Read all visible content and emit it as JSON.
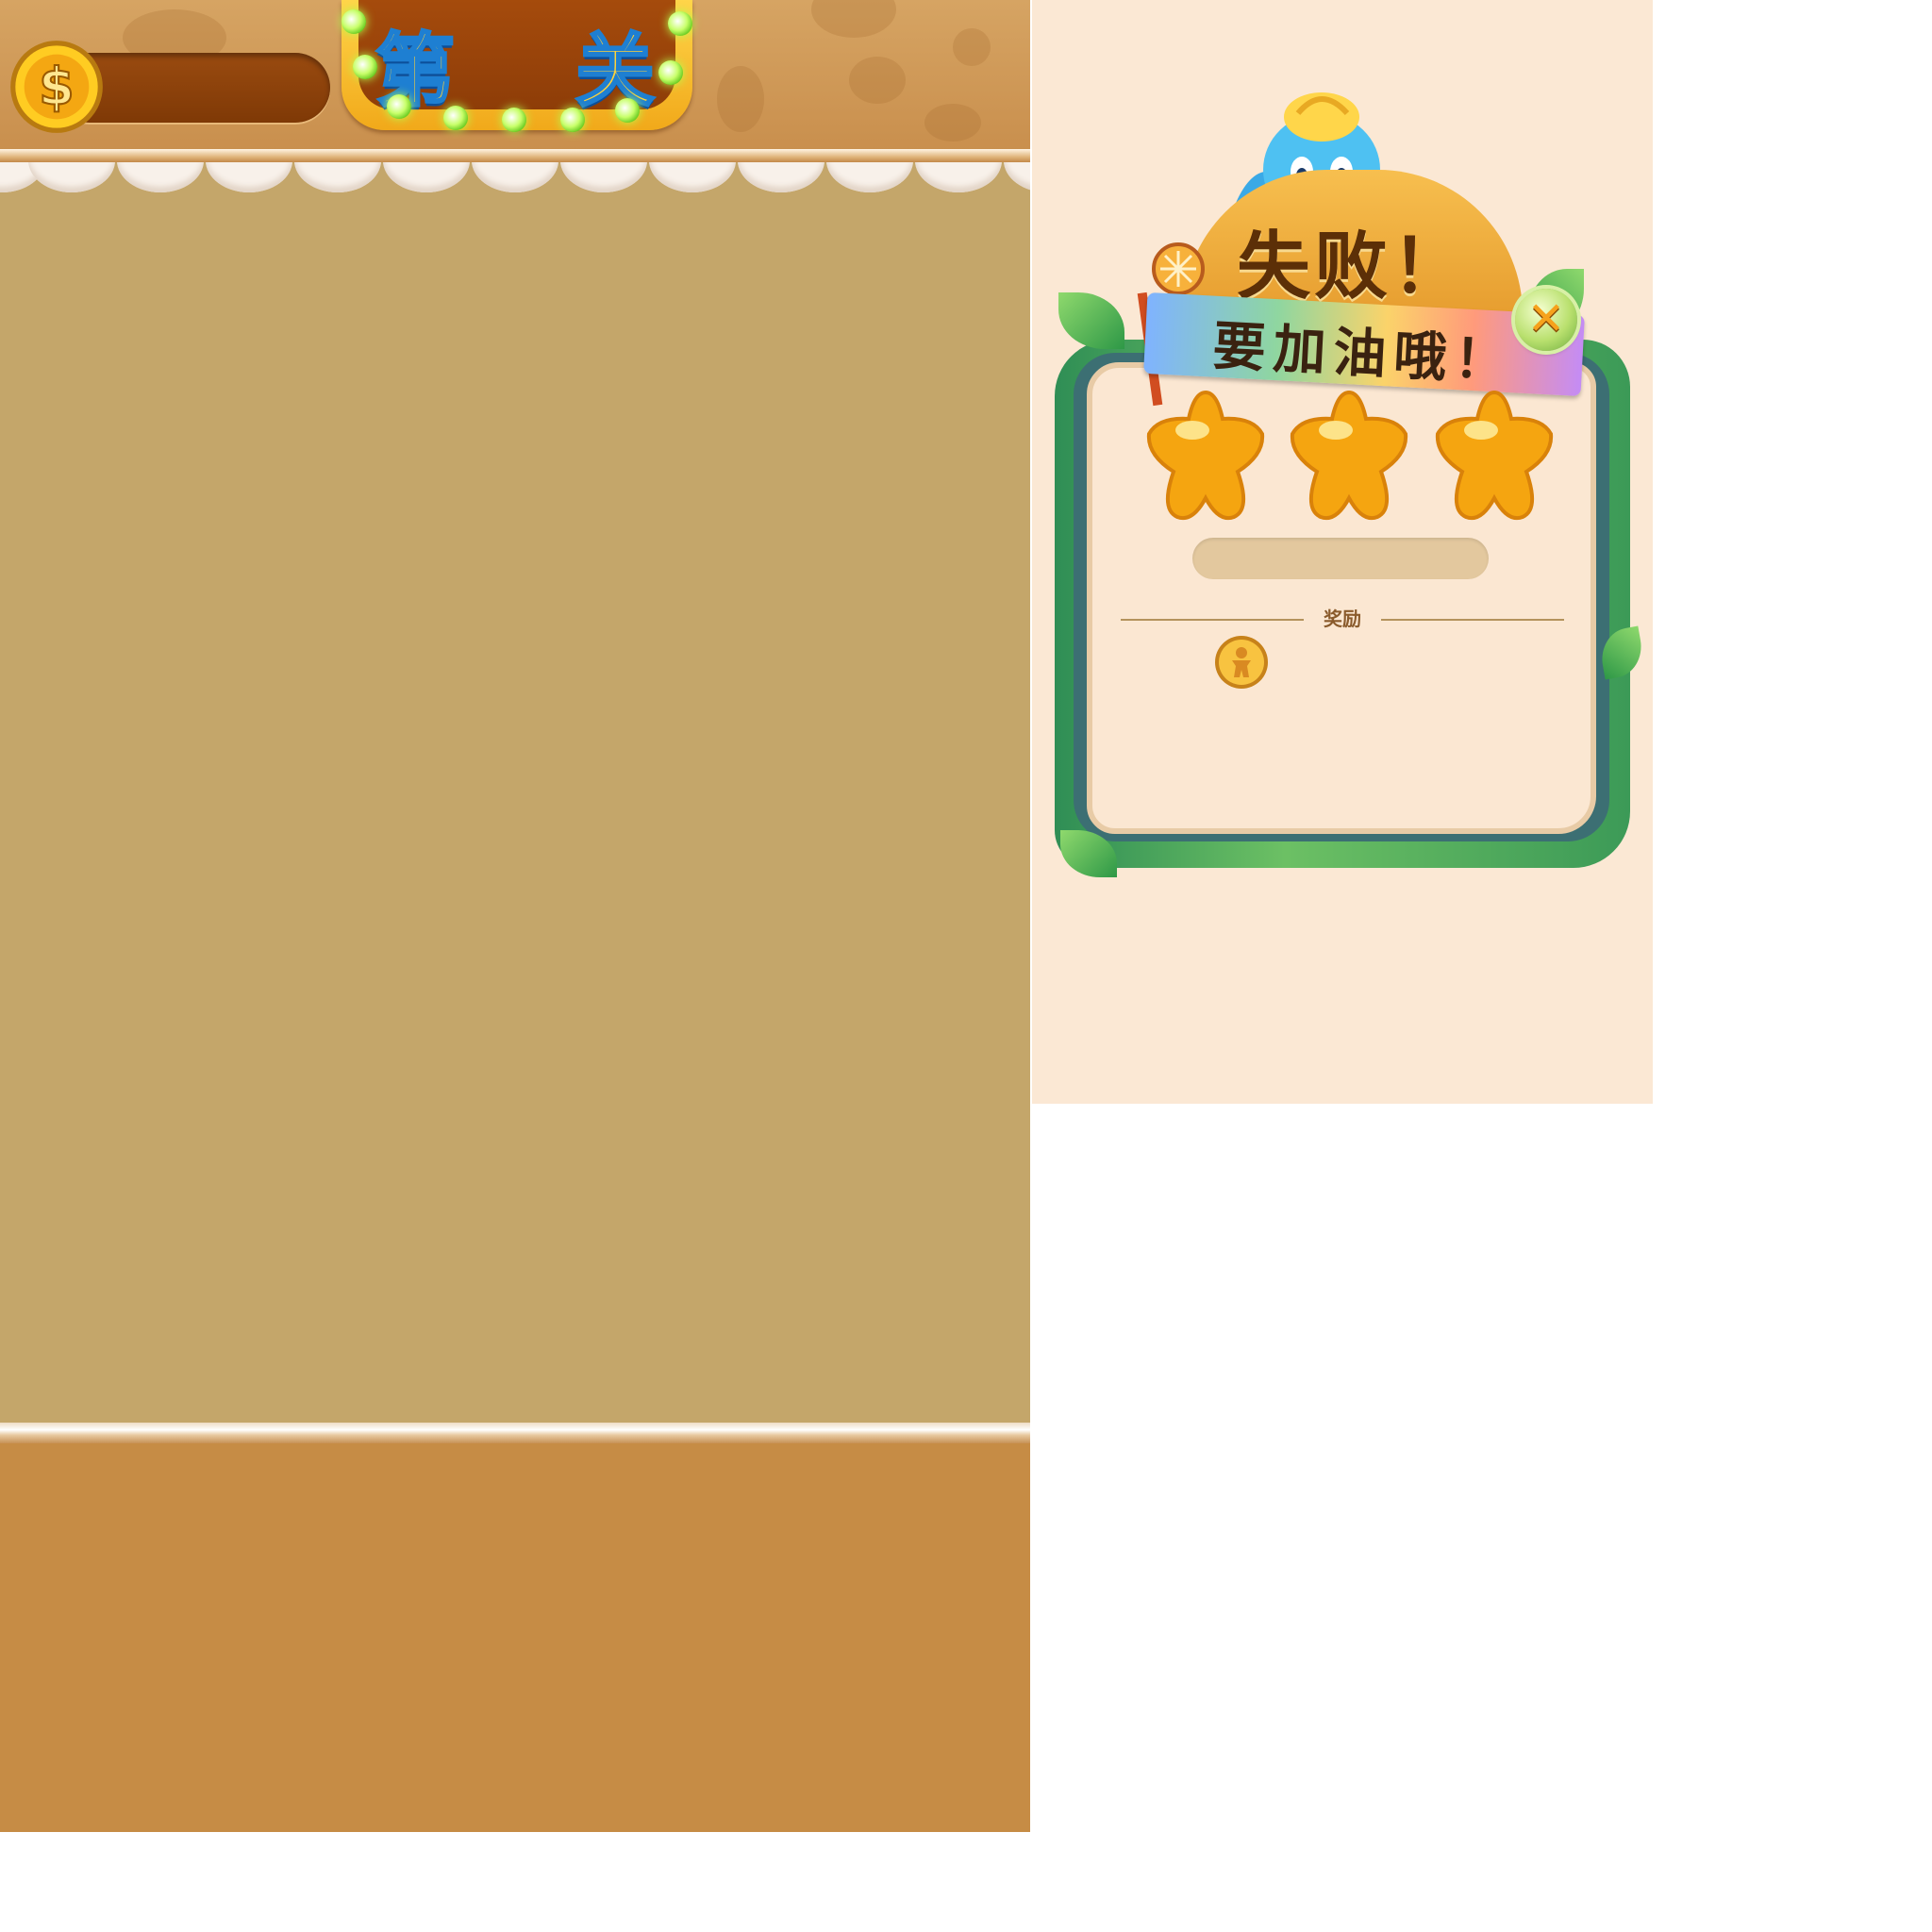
{
  "game": {
    "level_sign": {
      "prefix": "第",
      "suffix": "关"
    },
    "coins": {
      "value": ""
    },
    "colors": {
      "board": "#c4a66a",
      "footer": "#c68c45",
      "topbar": "#d6a463"
    }
  },
  "popup": {
    "title": "失败！",
    "banner": "要加油哦！",
    "stars": [
      {
        "icon": "star-icon",
        "filled": true
      },
      {
        "icon": "star-icon",
        "filled": true
      },
      {
        "icon": "star-icon",
        "filled": true
      }
    ],
    "reward_label": "奖励",
    "reward_icon": "gingerbread-coin-icon",
    "close_icon": "close-icon",
    "colors": {
      "paper": "#fbe7d2",
      "vine": "#3c9a57",
      "sign": "#e59a2c",
      "title_text": "#5c2f07"
    }
  }
}
